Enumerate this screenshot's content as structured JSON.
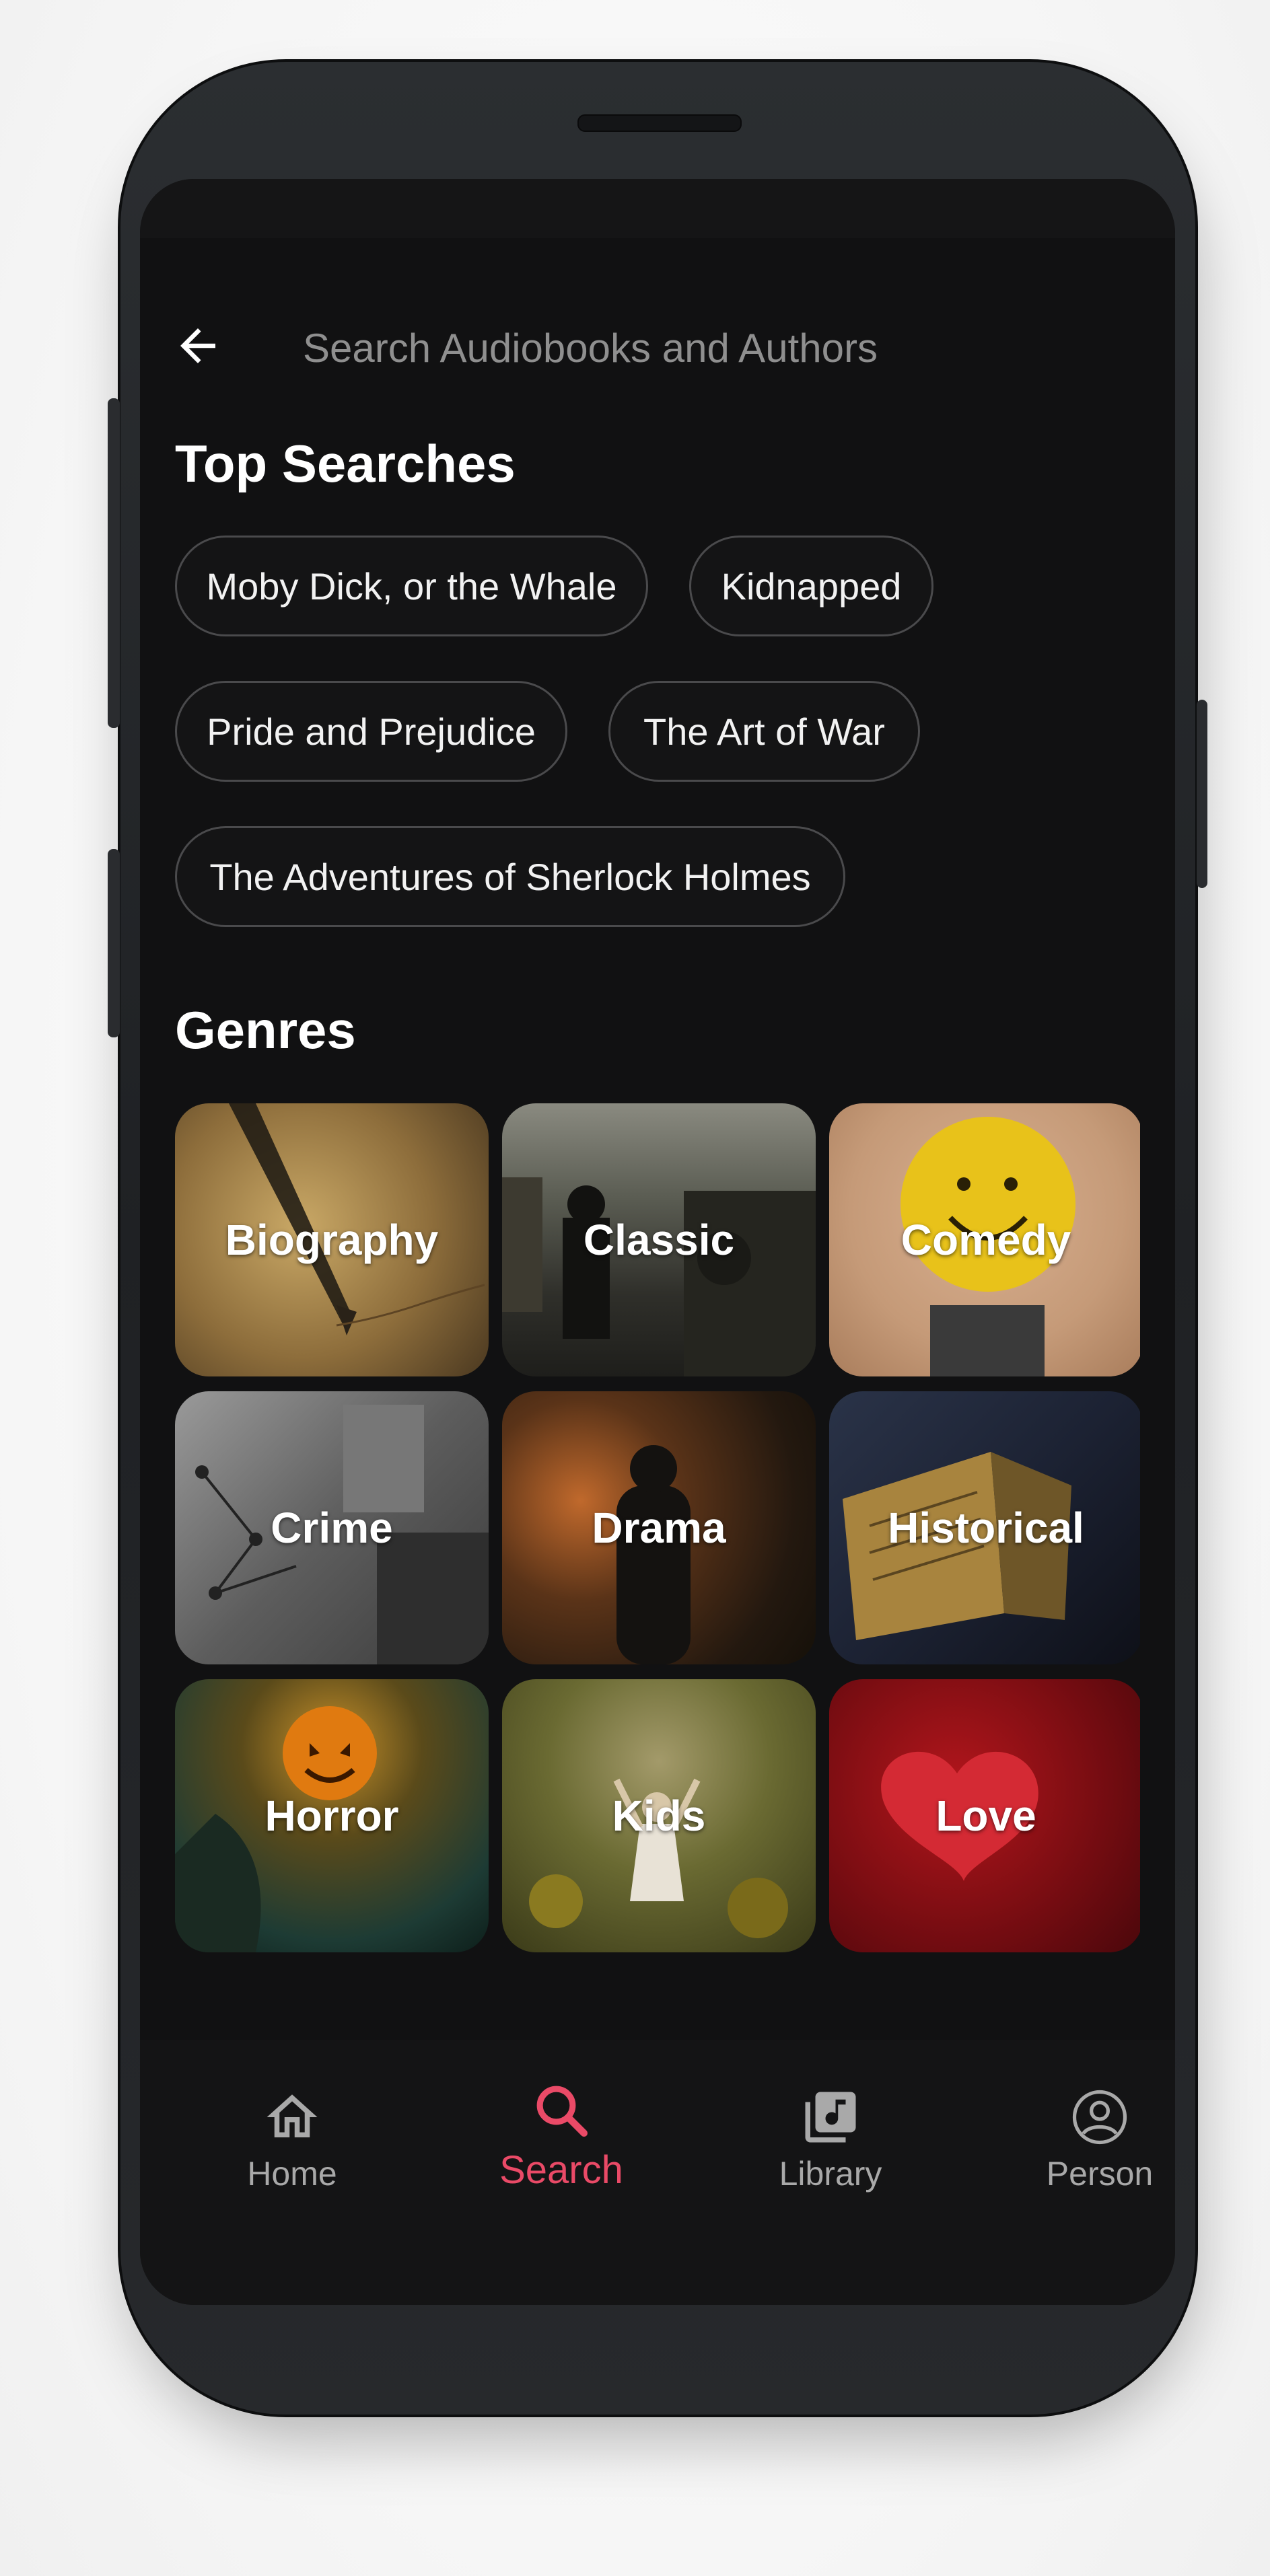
{
  "search": {
    "placeholder": "Search Audiobooks and Authors",
    "back_icon": "arrow-left-icon"
  },
  "top_searches": {
    "title": "Top Searches",
    "chips": [
      "Moby Dick, or the Whale",
      "Kidnapped",
      "Pride and Prejudice",
      "The Art of War",
      "The Adventures of Sherlock Holmes"
    ]
  },
  "genres": {
    "title": "Genres",
    "items": [
      {
        "label": "Biography",
        "color": "#9a7b45"
      },
      {
        "label": "Classic",
        "color": "#3c3d38"
      },
      {
        "label": "Comedy",
        "color": "#c7a078"
      },
      {
        "label": "Crime",
        "color": "#6b6b6b"
      },
      {
        "label": "Drama",
        "color": "#3a2a1c"
      },
      {
        "label": "Historical",
        "color": "#2a2c35"
      },
      {
        "label": "Horror",
        "color": "#3d3a20"
      },
      {
        "label": "Kids",
        "color": "#5a5a2c"
      },
      {
        "label": "Love",
        "color": "#7a0d12"
      }
    ]
  },
  "bottom_nav": {
    "items": [
      {
        "label": "Home",
        "icon": "home-icon"
      },
      {
        "label": "Search",
        "icon": "search-icon"
      },
      {
        "label": "Library",
        "icon": "library-icon"
      },
      {
        "label": "Person",
        "icon": "person-icon"
      }
    ],
    "active_color": "#ea4a67",
    "inactive_color": "#a9a9a9"
  }
}
